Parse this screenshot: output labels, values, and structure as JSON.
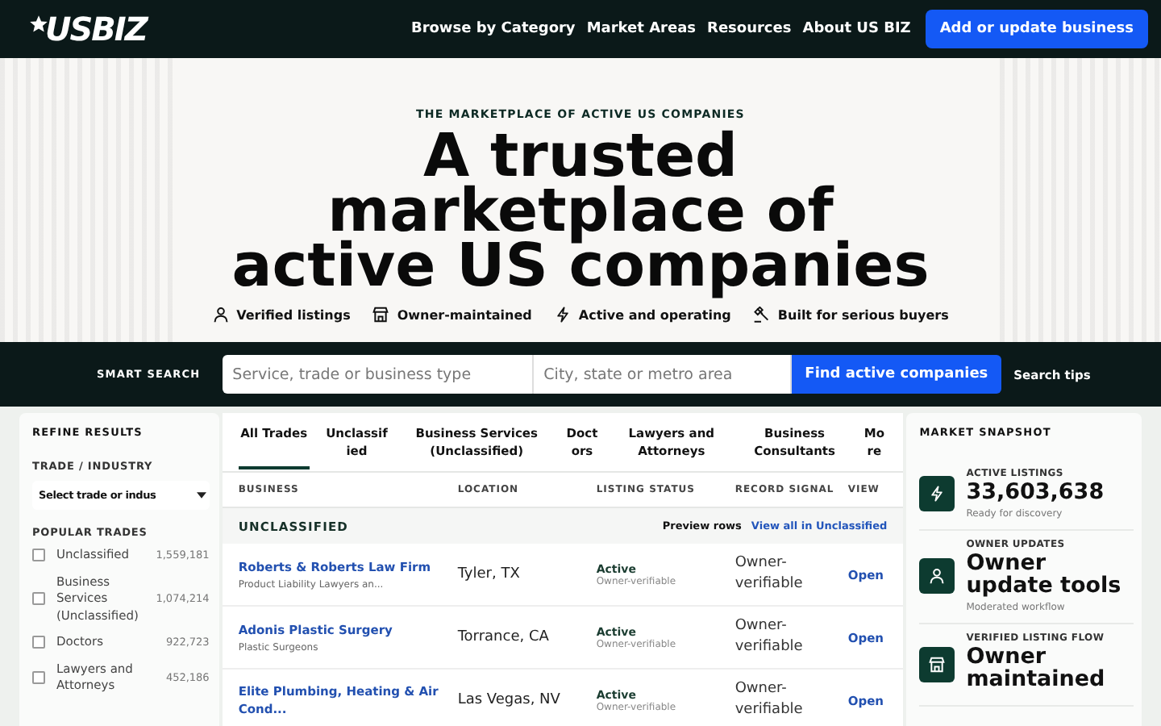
{
  "nav": {
    "logo": "USBIZ",
    "links": [
      "Browse by Category",
      "Market Areas",
      "Resources",
      "About US BIZ"
    ],
    "cta": "Add or update business"
  },
  "hero": {
    "eyebrow": "THE MARKETPLACE OF ACTIVE US COMPANIES",
    "title": "A trusted marketplace of active US companies",
    "features": [
      {
        "label": "Verified listings",
        "kind": "person"
      },
      {
        "label": "Owner-maintained",
        "kind": "store"
      },
      {
        "label": "Active and operating",
        "kind": "bolt"
      },
      {
        "label": "Built for serious buyers",
        "kind": "gavel"
      }
    ]
  },
  "search": {
    "label": "SMART SEARCH",
    "what_placeholder": "Service, trade or business type",
    "where_placeholder": "City, state or metro area",
    "button": "Find active companies",
    "tips": "Search tips"
  },
  "sidebar": {
    "title": "REFINE RESULTS",
    "trade_label": "TRADE / INDUSTRY",
    "select_value": "Select trade or indus",
    "popular_title": "POPULAR TRADES",
    "trades": [
      {
        "label": "Unclassified",
        "count": "1,559,181",
        "checked": false
      },
      {
        "label": "Business Services (Unclassified)",
        "count": "1,074,214",
        "checked": false
      },
      {
        "label": "Doctors",
        "count": "922,723",
        "checked": false
      },
      {
        "label": "Lawyers and Attorneys",
        "count": "452,186",
        "checked": false
      }
    ]
  },
  "tabs": [
    {
      "label": "All Trades",
      "selected": true
    },
    {
      "label": "Unclassified",
      "selected": false
    },
    {
      "label": "Business Services (Unclassified)",
      "selected": false
    },
    {
      "label": "Doctors",
      "selected": false
    },
    {
      "label": "Lawyers and Attorneys",
      "selected": false
    },
    {
      "label": "Business Consultants",
      "selected": false
    },
    {
      "label": "More",
      "selected": false
    }
  ],
  "table": {
    "columns": [
      "BUSINESS",
      "LOCATION",
      "LISTING STATUS",
      "RECORD SIGNAL",
      "VIEW"
    ],
    "group": {
      "title": "UNCLASSIFIED",
      "preview": "Preview rows",
      "link": "View all in Unclassified"
    },
    "rows": [
      {
        "name": "Roberts & Roberts Law Firm",
        "sub": "Product Liability Lawyers an...",
        "location": "Tyler, TX",
        "status": "Active",
        "status_sub": "Owner-verifiable",
        "signal": "Owner-verifiable",
        "view": "Open"
      },
      {
        "name": "Adonis Plastic Surgery",
        "sub": "Plastic Surgeons",
        "location": "Torrance, CA",
        "status": "Active",
        "status_sub": "Owner-verifiable",
        "signal": "Owner-verifiable",
        "view": "Open"
      },
      {
        "name": "Elite Plumbing, Heating & Air Cond...",
        "location": "Las Vegas, NV",
        "status": "Active",
        "status_sub": "Owner-verifiable",
        "signal": "Owner-verifiable",
        "view": "Open"
      }
    ]
  },
  "snapshot": {
    "title": "MARKET SNAPSHOT",
    "cards": [
      {
        "label": "ACTIVE LISTINGS",
        "value": "33,603,638",
        "sub": "Ready for discovery",
        "kind": "bolt"
      },
      {
        "label": "OWNER UPDATES",
        "value": "Owner update tools",
        "sub": "Moderated workflow",
        "kind": "person"
      },
      {
        "label": "VERIFIED LISTING FLOW",
        "value": "Owner maintained",
        "kind": "store"
      }
    ]
  }
}
